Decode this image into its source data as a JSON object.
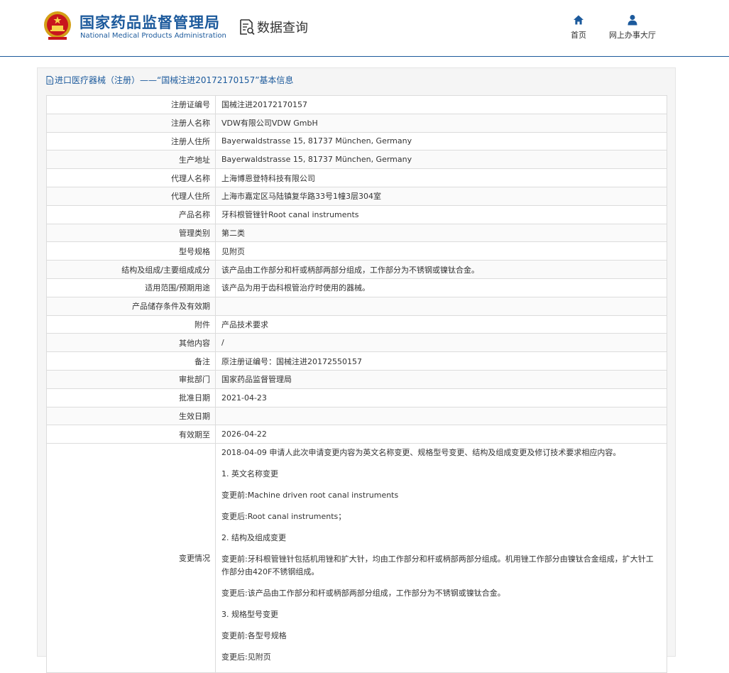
{
  "header": {
    "brand_cn": "国家药品监督管理局",
    "brand_en": "National Medical Products Administration",
    "search_label": "数据查询",
    "nav": [
      {
        "label": "首页",
        "icon": "home-icon"
      },
      {
        "label": "网上办事大厅",
        "icon": "user-icon"
      }
    ],
    "colors": {
      "brand": "#1c5a9c"
    }
  },
  "panel": {
    "title": "进口医疗器械（注册）——“国械注进20172170157”基本信息"
  },
  "rows": [
    {
      "label": "注册证编号",
      "value": "国械注进20172170157"
    },
    {
      "label": "注册人名称",
      "value": "VDW有限公司VDW GmbH"
    },
    {
      "label": "注册人住所",
      "value": "Bayerwaldstrasse 15, 81737 München, Germany"
    },
    {
      "label": "生产地址",
      "value": "Bayerwaldstrasse 15, 81737 München, Germany"
    },
    {
      "label": "代理人名称",
      "value": "上海博恩登特科技有限公司"
    },
    {
      "label": "代理人住所",
      "value": "上海市嘉定区马陆镇复华路33号1幢3层304室"
    },
    {
      "label": "产品名称",
      "value": "牙科根管锉针Root canal instruments"
    },
    {
      "label": "管理类别",
      "value": "第二类"
    },
    {
      "label": "型号规格",
      "value": "见附页"
    },
    {
      "label": "结构及组成/主要组成成分",
      "value": "该产品由工作部分和杆或柄部两部分组成，工作部分为不锈钢或镍钛合金。"
    },
    {
      "label": "适用范围/预期用途",
      "value": "该产品为用于齿科根管治疗时使用的器械。"
    },
    {
      "label": "产品储存条件及有效期",
      "value": ""
    },
    {
      "label": "附件",
      "value": "产品技术要求"
    },
    {
      "label": "其他内容",
      "value": "/"
    },
    {
      "label": "备注",
      "value": "原注册证编号：国械注进20172550157"
    },
    {
      "label": "审批部门",
      "value": "国家药品监督管理局"
    },
    {
      "label": "批准日期",
      "value": "2021-04-23"
    },
    {
      "label": "生效日期",
      "value": ""
    },
    {
      "label": "有效期至",
      "value": "2026-04-22"
    }
  ],
  "change": {
    "label": "变更情况",
    "paragraphs": [
      "2018-04-09 申请人此次申请变更内容为英文名称变更、规格型号变更、结构及组成变更及修订技术要求相应内容。",
      "1. 英文名称变更",
      "变更前:Machine driven root canal instruments",
      "变更后:Root canal instruments；",
      "2. 结构及组成变更",
      "变更前:牙科根管锉针包括机用锉和扩大针，均由工作部分和杆或柄部两部分组成。机用锉工作部分由镍钛合金组成，扩大针工作部分由420F不锈钢组成。",
      "变更后:该产品由工作部分和杆或柄部两部分组成，工作部分为不锈钢或镍钛合金。",
      "3. 规格型号变更",
      "变更前:各型号规格",
      "变更后:见附页"
    ]
  }
}
